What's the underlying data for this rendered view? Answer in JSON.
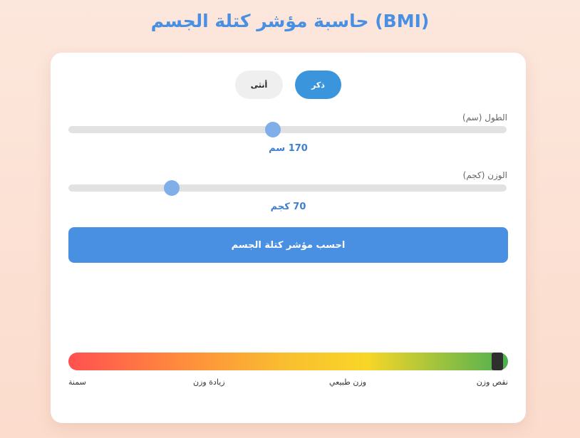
{
  "app": {
    "title": "حاسبة مؤشر كتلة الجسم (BMI)"
  },
  "gender": {
    "male_label": "ذكر",
    "female_label": "أنثى",
    "selected": "male"
  },
  "height": {
    "label": "الطول (سم)",
    "value_text": "170 سم",
    "value": 170,
    "min": 100,
    "max": 250
  },
  "weight": {
    "label": "الوزن (كجم)",
    "value_text": "70 كجم",
    "value": 70,
    "min": 30,
    "max": 200
  },
  "calculate": {
    "label": "احسب مؤشر كتلة الجسم"
  },
  "scale": {
    "labels": {
      "underweight": "نقص وزن",
      "normal": "وزن طبيعي",
      "overweight": "زيادة وزن",
      "obese": "سمنة"
    },
    "marker_fraction": 0.976
  },
  "colors": {
    "accent": "#4a90e2",
    "male_button": "#3a95dd",
    "slider_thumb": "#80aee8",
    "background": "#fce7dc"
  }
}
